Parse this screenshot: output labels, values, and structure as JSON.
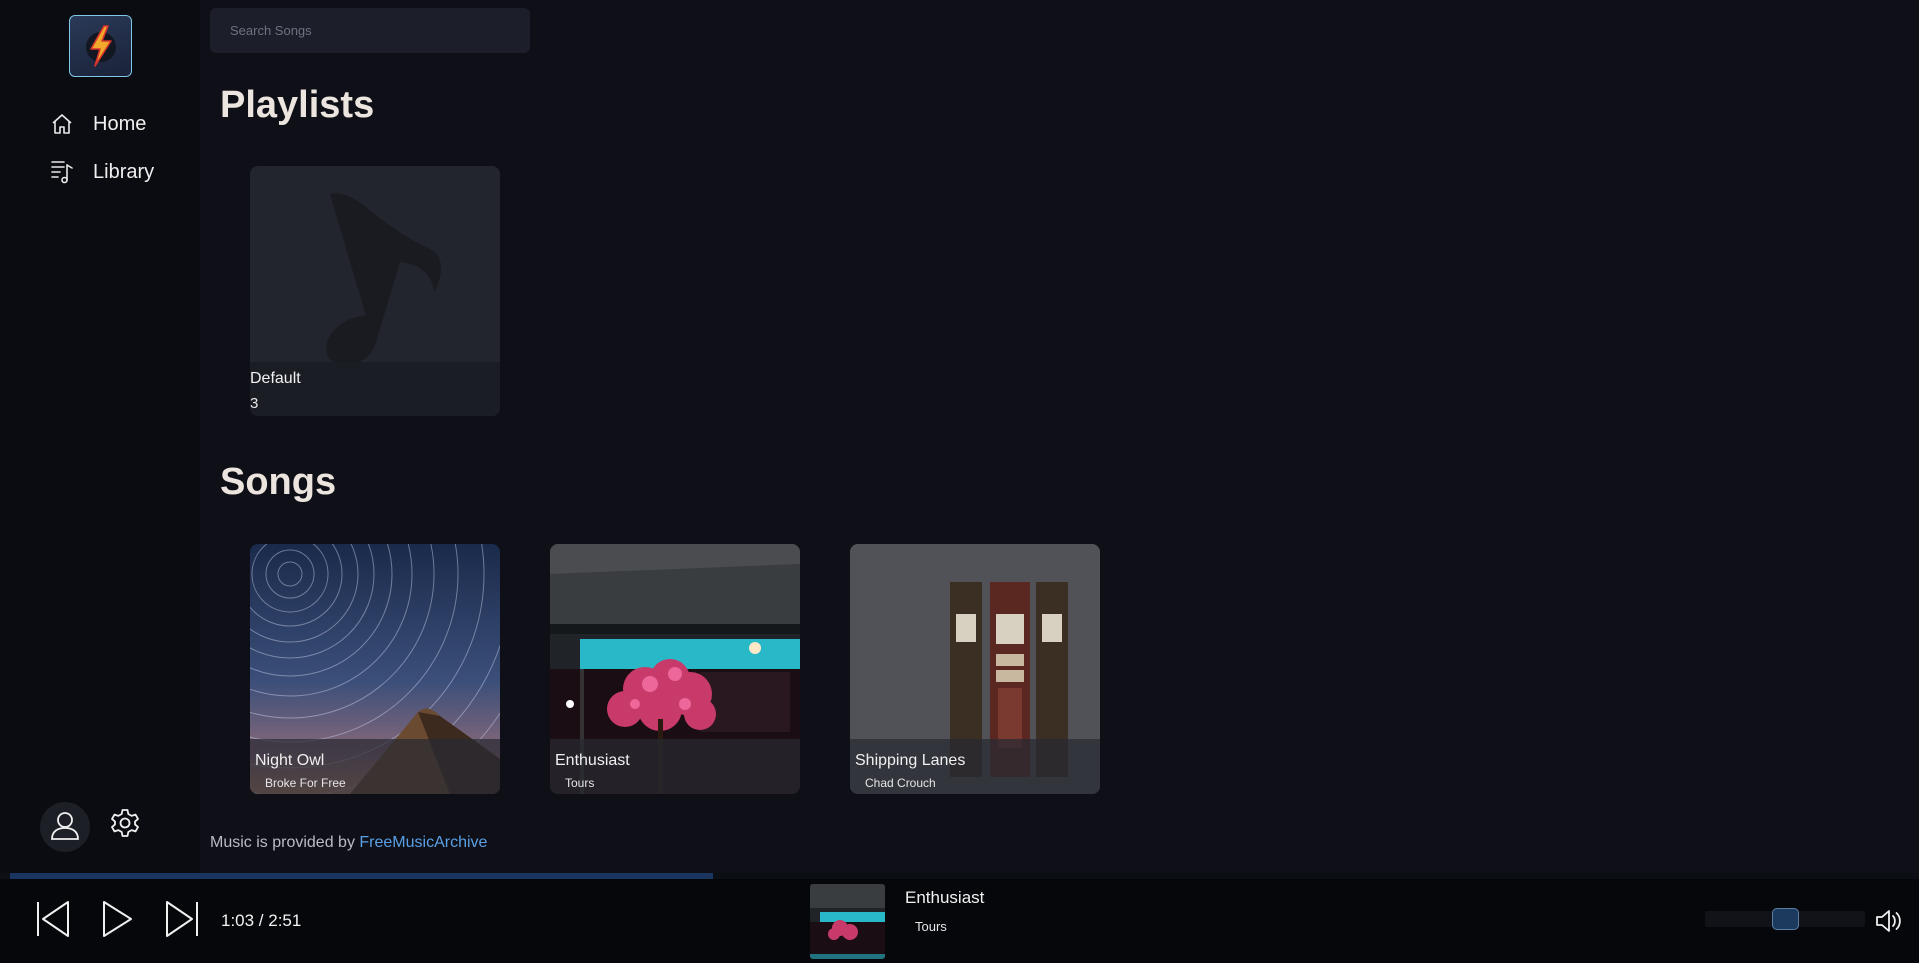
{
  "sidebar": {
    "nav": [
      {
        "label": "Home",
        "icon": "home-icon"
      },
      {
        "label": "Library",
        "icon": "library-icon"
      }
    ],
    "account_icon": "user-icon",
    "settings_icon": "gear-icon"
  },
  "search": {
    "placeholder": "Search Songs",
    "value": ""
  },
  "sections": {
    "playlists_title": "Playlists",
    "songs_title": "Songs"
  },
  "playlists": [
    {
      "name": "Default",
      "count": "3"
    }
  ],
  "songs": [
    {
      "title": "Night Owl",
      "artist": "Broke For Free"
    },
    {
      "title": "Enthusiast",
      "artist": "Tours"
    },
    {
      "title": "Shipping Lanes",
      "artist": "Chad Crouch"
    }
  ],
  "credit": {
    "text": "Music is provided by ",
    "link": "FreeMusicArchive"
  },
  "player": {
    "time": "1:03 / 2:51",
    "progress": 0.368,
    "volume": 0.5,
    "now_playing": {
      "title": "Enthusiast",
      "artist": "Tours"
    }
  },
  "colors": {
    "background": "#0e0f17",
    "sidebar": "#0b0c11",
    "accent": "#5aa0e6"
  }
}
